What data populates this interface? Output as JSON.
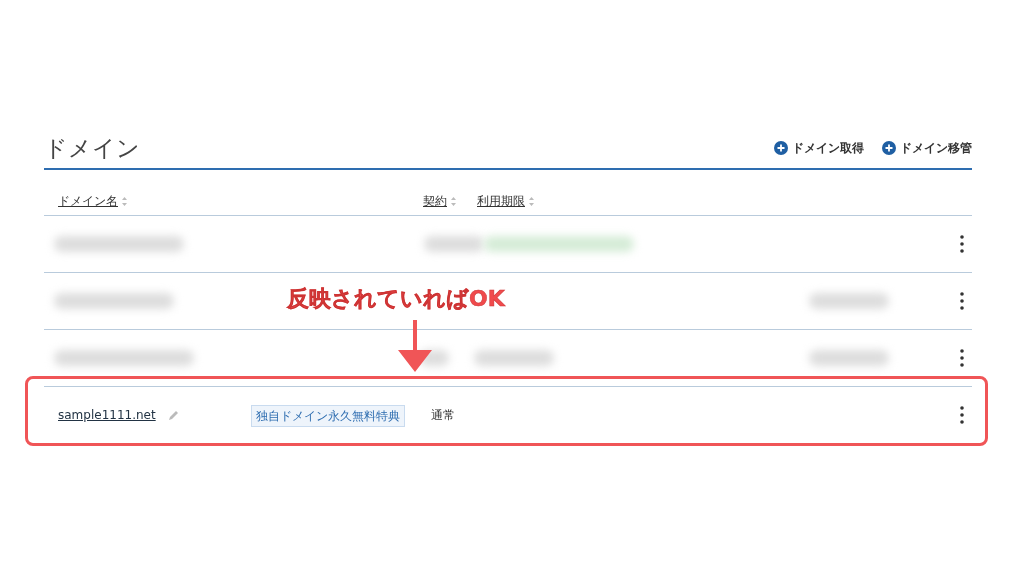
{
  "title": "ドメイン",
  "actions": [
    {
      "label": "ドメイン取得"
    },
    {
      "label": "ドメイン移管"
    }
  ],
  "table": {
    "columns": [
      {
        "label": "ドメイン名"
      },
      {
        "label": "契約"
      },
      {
        "label": "利用期限"
      }
    ],
    "rows": [
      {
        "kind": "redacted"
      },
      {
        "kind": "redacted"
      },
      {
        "kind": "redacted"
      },
      {
        "kind": "domain",
        "domain": "sample1111.net",
        "badge": "独自ドメイン永久無料特典",
        "contract": "通常",
        "highlighted": true
      }
    ]
  },
  "annotation": {
    "text": "反映されていればOK"
  }
}
